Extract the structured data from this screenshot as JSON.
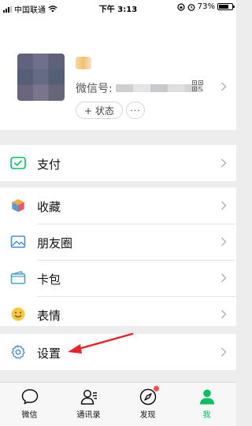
{
  "status_bar": {
    "carrier": "中国联通",
    "time": "下午 3:13",
    "battery": "73%",
    "battery_level": 0.73
  },
  "profile": {
    "wechat_id_label": "微信号:",
    "status_button_label": "+ 状态",
    "more_label": "···"
  },
  "menu": {
    "pay": {
      "label": "支付",
      "icon": "pay-icon"
    },
    "favorites": {
      "label": "收藏",
      "icon": "cube-icon"
    },
    "moments": {
      "label": "朋友圈",
      "icon": "picture-icon"
    },
    "cards": {
      "label": "卡包",
      "icon": "wallet-icon"
    },
    "stickers": {
      "label": "表情",
      "icon": "smiley-icon"
    },
    "settings": {
      "label": "设置",
      "icon": "gear-icon"
    }
  },
  "tabs": [
    {
      "label": "微信",
      "icon": "chat-bubble-icon",
      "active": false
    },
    {
      "label": "通讯录",
      "icon": "contacts-icon",
      "active": false
    },
    {
      "label": "发现",
      "icon": "compass-icon",
      "active": false,
      "badge": true
    },
    {
      "label": "我",
      "icon": "person-icon",
      "active": true
    }
  ],
  "colors": {
    "accent_green": "#07c160",
    "background": "#ededed",
    "badge_red": "#fa5151",
    "annotation_red": "#e8202a"
  }
}
